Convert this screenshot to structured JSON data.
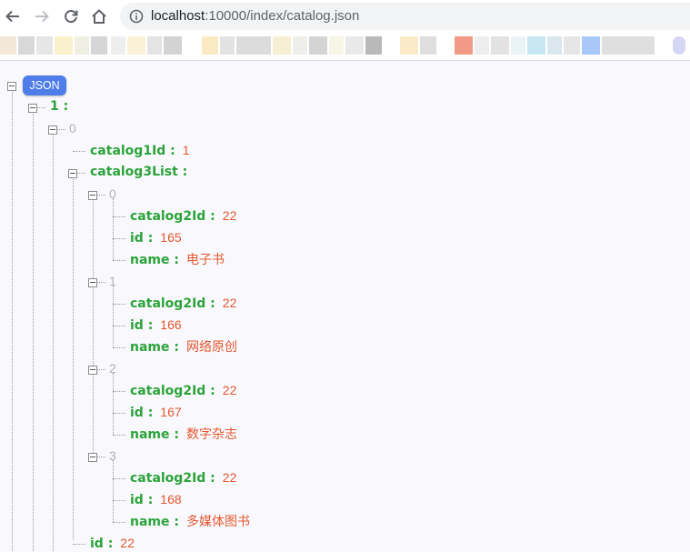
{
  "browser": {
    "url_host": "localhost",
    "url_rest": ":10000/index/catalog.json"
  },
  "json_viewer": {
    "root_badge": "JSON",
    "key_1": "1 :",
    "item_0_index": "0",
    "catalog1Id_key": "catalog1Id :",
    "catalog1Id_value": "1",
    "catalog3List_key": "catalog3List :",
    "entries": [
      {
        "index": "0",
        "catalog2Id_key": "catalog2Id :",
        "catalog2Id_value": "22",
        "id_key": "id :",
        "id_value": "165",
        "name_key": "name :",
        "name_value": "电子书"
      },
      {
        "index": "1",
        "catalog2Id_key": "catalog2Id :",
        "catalog2Id_value": "22",
        "id_key": "id :",
        "id_value": "166",
        "name_key": "name :",
        "name_value": "网络原创"
      },
      {
        "index": "2",
        "catalog2Id_key": "catalog2Id :",
        "catalog2Id_value": "22",
        "id_key": "id :",
        "id_value": "167",
        "name_key": "name :",
        "name_value": "数字杂志"
      },
      {
        "index": "3",
        "catalog2Id_key": "catalog2Id :",
        "catalog2Id_value": "22",
        "id_key": "id :",
        "id_value": "168",
        "name_key": "name :",
        "name_value": "多媒体图书"
      }
    ],
    "id_key": "id :",
    "id_value": "22"
  },
  "colors": {
    "key": "#2ba33a",
    "value": "#e4572e",
    "index": "#b3b3b3",
    "badge": "#4e7dea"
  }
}
